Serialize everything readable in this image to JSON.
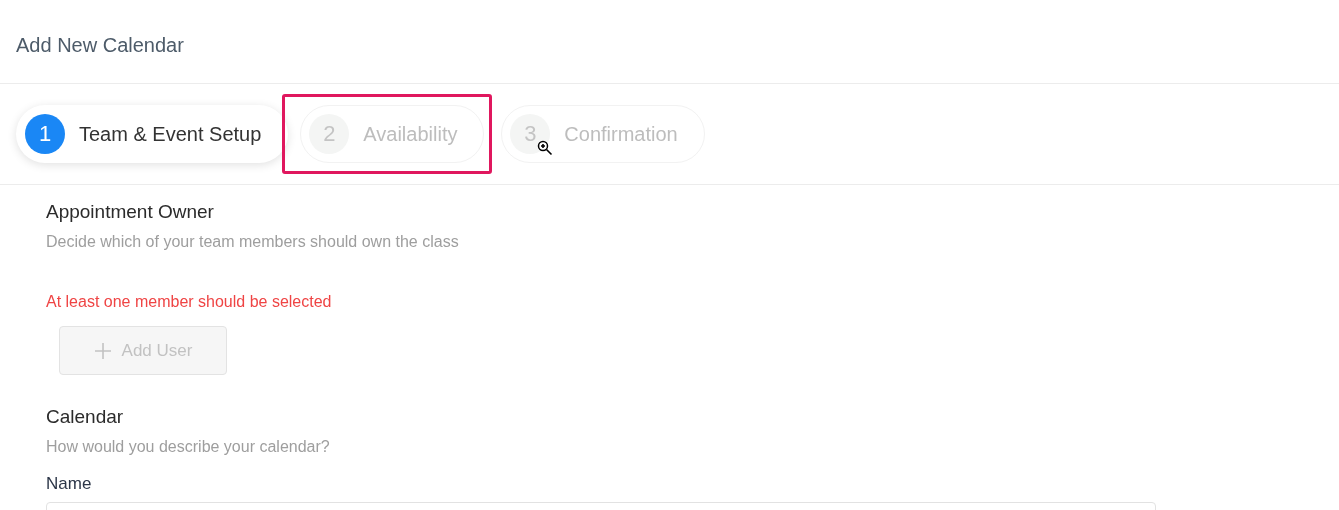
{
  "page_title": "Add New Calendar",
  "steps": [
    {
      "number": "1",
      "label": "Team & Event Setup",
      "selected": true,
      "highlighted": false
    },
    {
      "number": "2",
      "label": "Availability",
      "selected": false,
      "highlighted": true
    },
    {
      "number": "3",
      "label": "Confirmation",
      "selected": false,
      "highlighted": false
    }
  ],
  "owner_section": {
    "title": "Appointment Owner",
    "description": "Decide which of your team members should own the class",
    "error": "At least one member should be selected",
    "add_button": {
      "label": "Add User",
      "disabled": true
    }
  },
  "calendar_section": {
    "title": "Calendar",
    "description": "How would you describe your calendar?",
    "field_label": "Name"
  }
}
